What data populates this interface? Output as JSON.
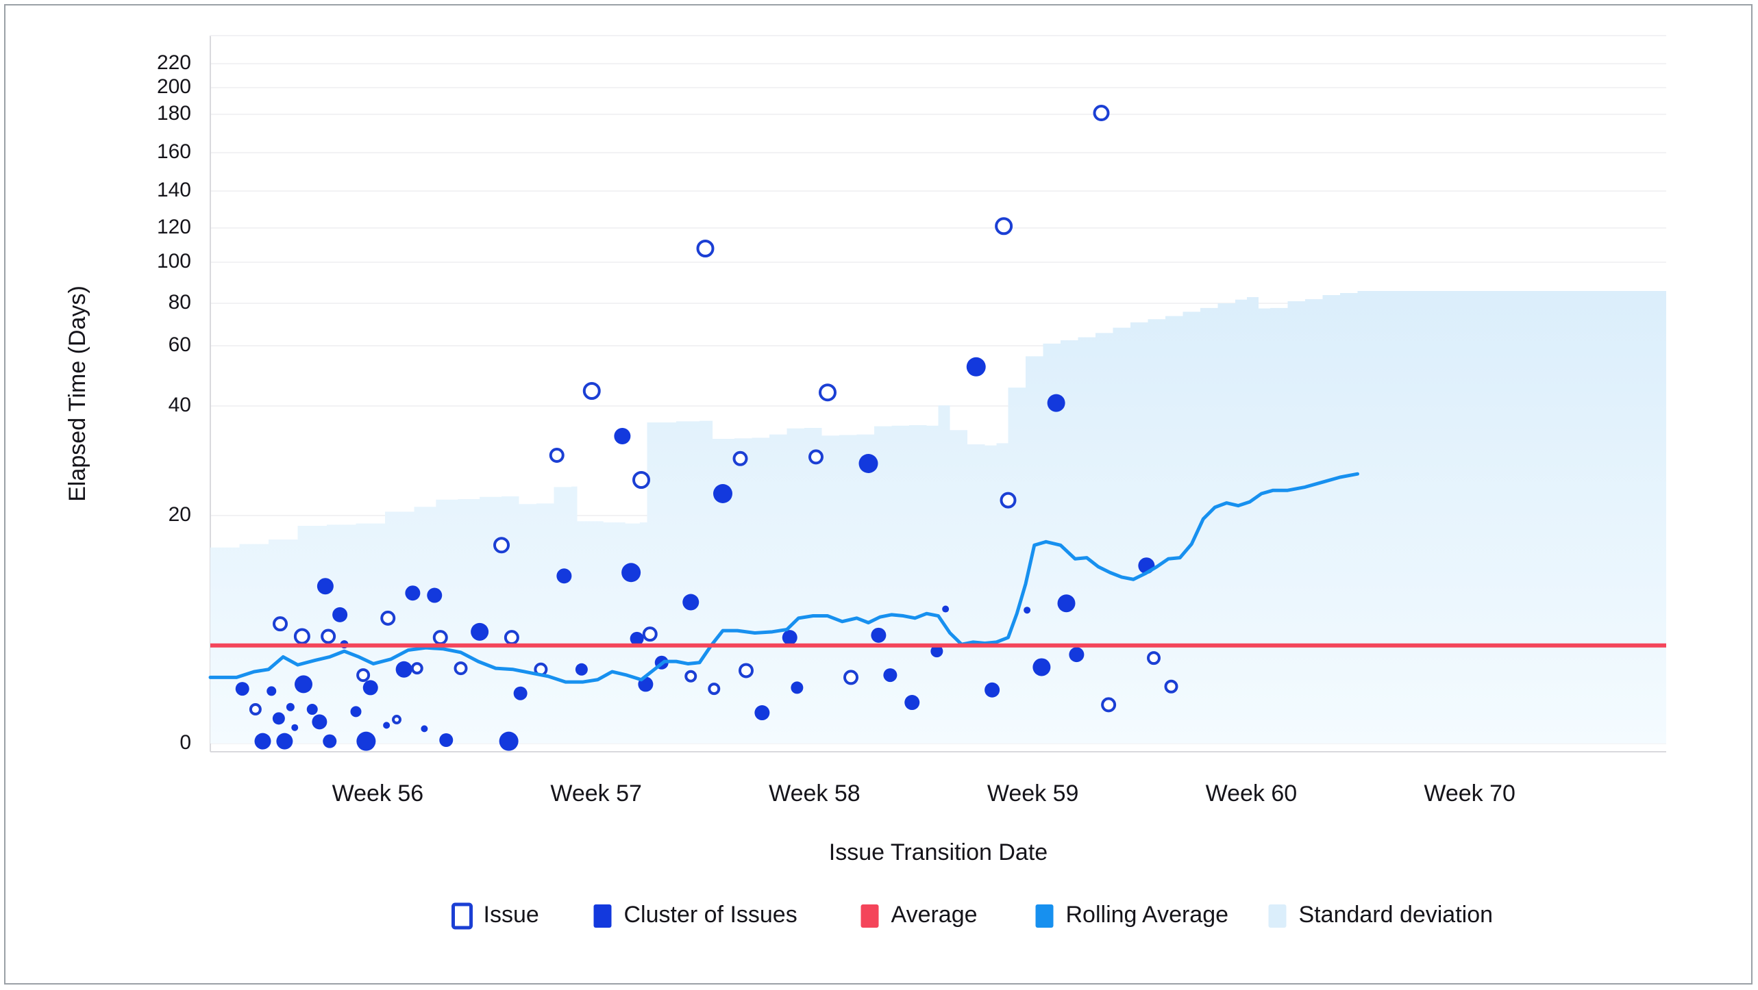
{
  "chart_data": {
    "type": "scatter",
    "title": "",
    "xlabel": "Issue Transition Date",
    "ylabel": "Elapsed Time (Days)",
    "grid": true,
    "legend_position": "bottom",
    "yticks": [
      0,
      20,
      40,
      60,
      80,
      100,
      120,
      140,
      160,
      180,
      200,
      220
    ],
    "ytick_labels": [
      "0",
      "20",
      "40",
      "60",
      "80",
      "100",
      "120",
      "140",
      "160",
      "180",
      "200",
      "220"
    ],
    "ylim": [
      0,
      228
    ],
    "xticks": [
      0.115,
      0.265,
      0.415,
      0.565,
      0.715,
      0.865
    ],
    "xtick_labels": [
      "Week 56",
      "Week 57",
      "Week 58",
      "Week 59",
      "Week 60",
      "Week 70"
    ],
    "xlim": [
      0,
      1
    ],
    "series": [
      {
        "name": "Issue",
        "type": "scatter-open",
        "color": "#ffffff",
        "edge_color": "#1b3fd4",
        "points": [
          {
            "x": 0.031,
            "y": 3.0,
            "r": 7
          },
          {
            "x": 0.048,
            "y": 10.5,
            "r": 9
          },
          {
            "x": 0.063,
            "y": 9.4,
            "r": 10
          },
          {
            "x": 0.081,
            "y": 9.4,
            "r": 9
          },
          {
            "x": 0.105,
            "y": 6.0,
            "r": 8
          },
          {
            "x": 0.122,
            "y": 11.0,
            "r": 9
          },
          {
            "x": 0.142,
            "y": 6.6,
            "r": 7
          },
          {
            "x": 0.158,
            "y": 9.3,
            "r": 9
          },
          {
            "x": 0.172,
            "y": 6.6,
            "r": 8
          },
          {
            "x": 0.2,
            "y": 17.4,
            "r": 10
          },
          {
            "x": 0.207,
            "y": 9.3,
            "r": 9
          },
          {
            "x": 0.227,
            "y": 6.5,
            "r": 8
          },
          {
            "x": 0.238,
            "y": 31.0,
            "r": 9
          },
          {
            "x": 0.262,
            "y": 45.0,
            "r": 11
          },
          {
            "x": 0.296,
            "y": 26.5,
            "r": 11
          },
          {
            "x": 0.302,
            "y": 9.6,
            "r": 9
          },
          {
            "x": 0.34,
            "y": 108.0,
            "r": 11
          },
          {
            "x": 0.346,
            "y": 4.8,
            "r": 7
          },
          {
            "x": 0.364,
            "y": 30.4,
            "r": 9
          },
          {
            "x": 0.368,
            "y": 6.4,
            "r": 9
          },
          {
            "x": 0.416,
            "y": 30.7,
            "r": 9
          },
          {
            "x": 0.424,
            "y": 44.5,
            "r": 11
          },
          {
            "x": 0.44,
            "y": 5.8,
            "r": 9
          },
          {
            "x": 0.545,
            "y": 121.0,
            "r": 11
          },
          {
            "x": 0.548,
            "y": 22.8,
            "r": 10
          },
          {
            "x": 0.612,
            "y": 181.0,
            "r": 10
          },
          {
            "x": 0.617,
            "y": 3.4,
            "r": 9
          },
          {
            "x": 0.648,
            "y": 7.5,
            "r": 8
          },
          {
            "x": 0.66,
            "y": 5.0,
            "r": 8
          },
          {
            "x": 0.33,
            "y": 5.9,
            "r": 7
          },
          {
            "x": 0.128,
            "y": 2.1,
            "r": 5
          }
        ]
      },
      {
        "name": "Cluster of Issues",
        "type": "scatter-filled",
        "color": "#1339dd",
        "points": [
          {
            "x": 0.022,
            "y": 4.8,
            "r": 10
          },
          {
            "x": 0.036,
            "y": 0.2,
            "r": 12
          },
          {
            "x": 0.042,
            "y": 4.6,
            "r": 7
          },
          {
            "x": 0.047,
            "y": 2.2,
            "r": 9
          },
          {
            "x": 0.051,
            "y": 0.2,
            "r": 12
          },
          {
            "x": 0.055,
            "y": 3.2,
            "r": 6
          },
          {
            "x": 0.058,
            "y": 1.4,
            "r": 5
          },
          {
            "x": 0.064,
            "y": 5.2,
            "r": 13
          },
          {
            "x": 0.07,
            "y": 3.0,
            "r": 8
          },
          {
            "x": 0.075,
            "y": 1.9,
            "r": 11
          },
          {
            "x": 0.079,
            "y": 13.8,
            "r": 12
          },
          {
            "x": 0.082,
            "y": 0.2,
            "r": 10
          },
          {
            "x": 0.089,
            "y": 11.3,
            "r": 11
          },
          {
            "x": 0.092,
            "y": 8.7,
            "r": 6
          },
          {
            "x": 0.1,
            "y": 2.8,
            "r": 8
          },
          {
            "x": 0.107,
            "y": 0.2,
            "r": 14
          },
          {
            "x": 0.11,
            "y": 4.9,
            "r": 11
          },
          {
            "x": 0.121,
            "y": 1.6,
            "r": 5
          },
          {
            "x": 0.133,
            "y": 6.5,
            "r": 12
          },
          {
            "x": 0.139,
            "y": 13.2,
            "r": 11
          },
          {
            "x": 0.147,
            "y": 1.3,
            "r": 5
          },
          {
            "x": 0.154,
            "y": 13.0,
            "r": 11
          },
          {
            "x": 0.162,
            "y": 0.3,
            "r": 10
          },
          {
            "x": 0.185,
            "y": 9.8,
            "r": 13
          },
          {
            "x": 0.205,
            "y": 0.2,
            "r": 14
          },
          {
            "x": 0.213,
            "y": 4.4,
            "r": 10
          },
          {
            "x": 0.243,
            "y": 14.7,
            "r": 11
          },
          {
            "x": 0.255,
            "y": 6.5,
            "r": 9
          },
          {
            "x": 0.283,
            "y": 34.5,
            "r": 12
          },
          {
            "x": 0.289,
            "y": 15.0,
            "r": 14
          },
          {
            "x": 0.293,
            "y": 9.2,
            "r": 10
          },
          {
            "x": 0.299,
            "y": 5.2,
            "r": 11
          },
          {
            "x": 0.31,
            "y": 7.1,
            "r": 10
          },
          {
            "x": 0.33,
            "y": 12.4,
            "r": 12
          },
          {
            "x": 0.352,
            "y": 24.0,
            "r": 14
          },
          {
            "x": 0.379,
            "y": 2.7,
            "r": 11
          },
          {
            "x": 0.398,
            "y": 9.3,
            "r": 11
          },
          {
            "x": 0.403,
            "y": 4.9,
            "r": 9
          },
          {
            "x": 0.452,
            "y": 29.5,
            "r": 14
          },
          {
            "x": 0.459,
            "y": 9.5,
            "r": 11
          },
          {
            "x": 0.467,
            "y": 6.0,
            "r": 10
          },
          {
            "x": 0.482,
            "y": 3.6,
            "r": 11
          },
          {
            "x": 0.499,
            "y": 8.1,
            "r": 9
          },
          {
            "x": 0.505,
            "y": 11.8,
            "r": 5
          },
          {
            "x": 0.526,
            "y": 53.0,
            "r": 14
          },
          {
            "x": 0.537,
            "y": 4.7,
            "r": 11
          },
          {
            "x": 0.561,
            "y": 11.7,
            "r": 5
          },
          {
            "x": 0.571,
            "y": 6.7,
            "r": 13
          },
          {
            "x": 0.581,
            "y": 41.0,
            "r": 13
          },
          {
            "x": 0.588,
            "y": 12.3,
            "r": 13
          },
          {
            "x": 0.595,
            "y": 7.8,
            "r": 11
          },
          {
            "x": 0.643,
            "y": 15.6,
            "r": 12
          }
        ]
      },
      {
        "name": "Average",
        "type": "hline",
        "color": "#f4455a",
        "value": 8.6
      },
      {
        "name": "Rolling Average",
        "type": "line",
        "color": "#1790ef",
        "values": [
          [
            0.0,
            5.8
          ],
          [
            0.018,
            5.8
          ],
          [
            0.03,
            6.3
          ],
          [
            0.04,
            6.5
          ],
          [
            0.05,
            7.6
          ],
          [
            0.06,
            6.9
          ],
          [
            0.072,
            7.3
          ],
          [
            0.082,
            7.6
          ],
          [
            0.092,
            8.1
          ],
          [
            0.102,
            7.6
          ],
          [
            0.112,
            7.0
          ],
          [
            0.124,
            7.4
          ],
          [
            0.136,
            8.2
          ],
          [
            0.148,
            8.4
          ],
          [
            0.16,
            8.3
          ],
          [
            0.172,
            8.0
          ],
          [
            0.184,
            7.2
          ],
          [
            0.196,
            6.6
          ],
          [
            0.208,
            6.5
          ],
          [
            0.22,
            6.2
          ],
          [
            0.232,
            5.9
          ],
          [
            0.244,
            5.4
          ],
          [
            0.256,
            5.4
          ],
          [
            0.266,
            5.6
          ],
          [
            0.276,
            6.3
          ],
          [
            0.286,
            6.0
          ],
          [
            0.296,
            5.6
          ],
          [
            0.304,
            6.4
          ],
          [
            0.312,
            7.2
          ],
          [
            0.32,
            7.2
          ],
          [
            0.328,
            7.0
          ],
          [
            0.336,
            7.1
          ],
          [
            0.344,
            8.6
          ],
          [
            0.352,
            9.9
          ],
          [
            0.362,
            9.9
          ],
          [
            0.374,
            9.7
          ],
          [
            0.386,
            9.8
          ],
          [
            0.396,
            10.0
          ],
          [
            0.404,
            11.0
          ],
          [
            0.414,
            11.2
          ],
          [
            0.424,
            11.2
          ],
          [
            0.434,
            10.7
          ],
          [
            0.444,
            11.0
          ],
          [
            0.452,
            10.6
          ],
          [
            0.46,
            11.1
          ],
          [
            0.468,
            11.3
          ],
          [
            0.476,
            11.2
          ],
          [
            0.484,
            11.0
          ],
          [
            0.492,
            11.4
          ],
          [
            0.5,
            11.2
          ],
          [
            0.508,
            9.7
          ],
          [
            0.516,
            8.7
          ],
          [
            0.524,
            8.9
          ],
          [
            0.532,
            8.8
          ],
          [
            0.54,
            8.9
          ],
          [
            0.548,
            9.3
          ],
          [
            0.554,
            11.4
          ],
          [
            0.56,
            14.0
          ],
          [
            0.566,
            17.4
          ],
          [
            0.574,
            17.7
          ],
          [
            0.584,
            17.4
          ],
          [
            0.594,
            16.2
          ],
          [
            0.602,
            16.3
          ],
          [
            0.61,
            15.5
          ],
          [
            0.618,
            15.0
          ],
          [
            0.626,
            14.6
          ],
          [
            0.634,
            14.4
          ],
          [
            0.642,
            14.9
          ],
          [
            0.65,
            15.5
          ],
          [
            0.658,
            16.2
          ],
          [
            0.666,
            16.3
          ],
          [
            0.674,
            17.5
          ],
          [
            0.682,
            19.7
          ],
          [
            0.69,
            21.5
          ],
          [
            0.698,
            22.3
          ],
          [
            0.706,
            21.8
          ],
          [
            0.714,
            22.5
          ],
          [
            0.722,
            24.0
          ],
          [
            0.73,
            24.6
          ],
          [
            0.74,
            24.6
          ],
          [
            0.752,
            25.2
          ],
          [
            0.764,
            26.1
          ],
          [
            0.776,
            27.0
          ],
          [
            0.788,
            27.6
          ]
        ]
      },
      {
        "name": "Standard deviation",
        "type": "band",
        "color": "#dbeefb",
        "values": [
          [
            0.0,
            17.2
          ],
          [
            0.02,
            17.5
          ],
          [
            0.04,
            17.9
          ],
          [
            0.06,
            19.1
          ],
          [
            0.08,
            19.2
          ],
          [
            0.1,
            19.3
          ],
          [
            0.12,
            20.7
          ],
          [
            0.14,
            21.6
          ],
          [
            0.155,
            22.9
          ],
          [
            0.17,
            23.0
          ],
          [
            0.185,
            23.4
          ],
          [
            0.2,
            23.5
          ],
          [
            0.212,
            22.1
          ],
          [
            0.224,
            22.2
          ],
          [
            0.236,
            25.2
          ],
          [
            0.248,
            25.3
          ],
          [
            0.252,
            19.5
          ],
          [
            0.27,
            19.4
          ],
          [
            0.285,
            19.3
          ],
          [
            0.295,
            19.4
          ],
          [
            0.3,
            37.0
          ],
          [
            0.32,
            37.2
          ],
          [
            0.336,
            37.3
          ],
          [
            0.345,
            34.0
          ],
          [
            0.36,
            34.1
          ],
          [
            0.372,
            34.2
          ],
          [
            0.384,
            34.8
          ],
          [
            0.396,
            35.9
          ],
          [
            0.408,
            36.0
          ],
          [
            0.42,
            34.6
          ],
          [
            0.432,
            34.7
          ],
          [
            0.444,
            34.8
          ],
          [
            0.456,
            36.3
          ],
          [
            0.468,
            36.4
          ],
          [
            0.48,
            36.5
          ],
          [
            0.492,
            36.4
          ],
          [
            0.5,
            40.2
          ],
          [
            0.508,
            35.6
          ],
          [
            0.52,
            33.0
          ],
          [
            0.532,
            32.8
          ],
          [
            0.54,
            33.2
          ],
          [
            0.548,
            46.1
          ],
          [
            0.56,
            56.5
          ],
          [
            0.572,
            61.0
          ],
          [
            0.584,
            62.6
          ],
          [
            0.596,
            64.0
          ],
          [
            0.608,
            66.0
          ],
          [
            0.62,
            68.5
          ],
          [
            0.632,
            71.0
          ],
          [
            0.644,
            72.5
          ],
          [
            0.656,
            74.0
          ],
          [
            0.668,
            76.0
          ],
          [
            0.68,
            77.8
          ],
          [
            0.692,
            80.0
          ],
          [
            0.704,
            81.8
          ],
          [
            0.712,
            83.0
          ],
          [
            0.72,
            77.6
          ],
          [
            0.728,
            77.8
          ],
          [
            0.74,
            81.0
          ],
          [
            0.752,
            82.0
          ],
          [
            0.764,
            84.0
          ],
          [
            0.776,
            85.0
          ],
          [
            0.788,
            86.0
          ]
        ]
      }
    ]
  },
  "legend": {
    "items": [
      {
        "label": "Issue",
        "marker": "open-square",
        "color": "#ffffff",
        "edge": "#1b3fd4"
      },
      {
        "label": "Cluster of Issues",
        "marker": "filled-square",
        "color": "#1339dd"
      },
      {
        "label": "Average",
        "marker": "filled-square",
        "color": "#f4455a"
      },
      {
        "label": "Rolling Average",
        "marker": "filled-square",
        "color": "#1790ef"
      },
      {
        "label": "Standard deviation",
        "marker": "filled-square",
        "color": "#dbeefb"
      }
    ]
  },
  "colors": {
    "issue_edge": "#1b3fd4",
    "cluster": "#1339dd",
    "average": "#f4455a",
    "rolling_average": "#1790ef",
    "std_band": "#dbeefb",
    "grid": "#f2f2f4",
    "axis": "#d9d9dd",
    "text": "#15141a",
    "frame": "#9aa0a6"
  }
}
